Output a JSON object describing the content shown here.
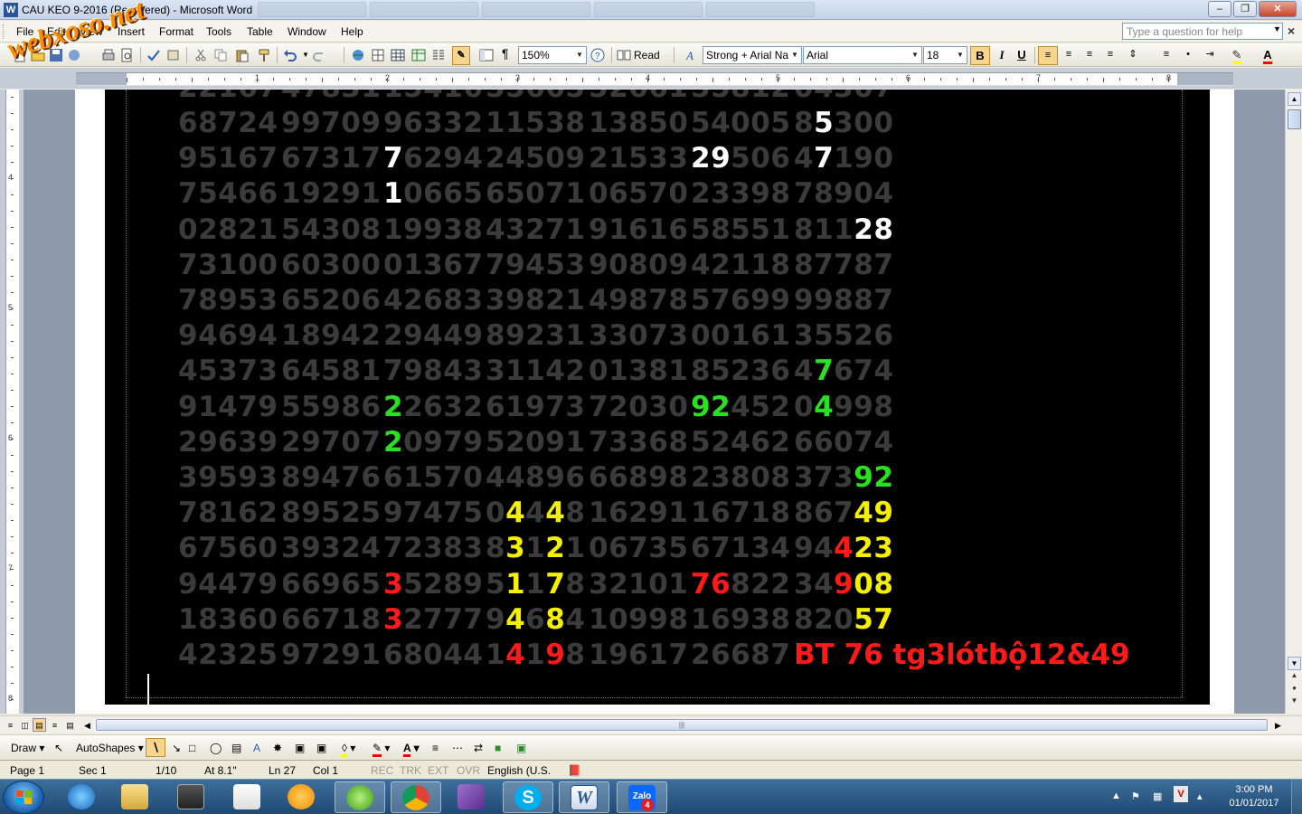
{
  "window": {
    "title": "CAU KEO 9-2016 (Recovered) - Microsoft Word",
    "controls": [
      "minimize",
      "restore",
      "close"
    ]
  },
  "watermark": "webxoso.net",
  "menu": {
    "items": [
      "File",
      "Edit",
      "View",
      "Insert",
      "Format",
      "Tools",
      "Table",
      "Window",
      "Help"
    ],
    "help_placeholder": "Type a question for help"
  },
  "toolbar": {
    "zoom": "150%",
    "read_label": "Read",
    "style": "Strong + Arial Na",
    "font": "Arial",
    "font_size": "18",
    "bold_label": "B",
    "italic_label": "I",
    "underline_label": "U"
  },
  "ruler": {
    "numbers": [
      "1",
      "2",
      "3",
      "4",
      "5",
      "6",
      "7",
      "8"
    ],
    "vnumbers": [
      "4",
      "5",
      "6",
      "7",
      "8"
    ]
  },
  "document": {
    "first_row_partial": [
      "22167",
      "47831",
      "15416",
      "55665",
      "52661",
      "55812",
      "04307"
    ],
    "rows": [
      [
        "68724",
        "99709",
        "96332",
        "11538",
        "13850",
        "54005",
        "85300"
      ],
      [
        "95167",
        "67317",
        "76294",
        "24509",
        "21533",
        "29506",
        "47190"
      ],
      [
        "75466",
        "19291",
        "10665",
        "65071",
        "06570",
        "23398",
        "78904"
      ],
      [
        "02821",
        "54308",
        "19938",
        "43271",
        "91616",
        "58551",
        "81128"
      ],
      [
        "73100",
        "60300",
        "01367",
        "79453",
        "90809",
        "42118",
        "87787"
      ],
      [
        "78953",
        "65206",
        "42683",
        "39821",
        "49878",
        "57699",
        "99887"
      ],
      [
        "94694",
        "18942",
        "29449",
        "89231",
        "33073",
        "00161",
        "35526"
      ],
      [
        "45373",
        "64581",
        "79843",
        "31142",
        "01381",
        "85236",
        "47674"
      ],
      [
        "91479",
        "55986",
        "22632",
        "61973",
        "72030",
        "92452",
        "04998"
      ],
      [
        "29639",
        "29707",
        "20979",
        "52091",
        "73368",
        "52462",
        "66074"
      ],
      [
        "39593",
        "89476",
        "61570",
        "44896",
        "66898",
        "23808",
        "37392"
      ],
      [
        "78162",
        "89525",
        "97475",
        "04448",
        "16291",
        "16718",
        "86749"
      ],
      [
        "67560",
        "39324",
        "72383",
        "83121",
        "06735",
        "67134",
        "94423"
      ],
      [
        "94479",
        "66965",
        "35289",
        "51178",
        "32101",
        "76822",
        "34908"
      ],
      [
        "18360",
        "66718",
        "32777",
        "94684",
        "10998",
        "16938",
        "82057"
      ],
      [
        "42325",
        "97291",
        "68044",
        "14198",
        "19617",
        "26687",
        ""
      ]
    ],
    "note": "BT 76 tg3lótbộ12&49",
    "highlight_colors": {
      "white": "#ffffff",
      "green": "#28e21f",
      "yellow": "#f5f000",
      "red": "#ff1a1a",
      "dim_digits": "#3b3b3b"
    }
  },
  "draw_toolbar": {
    "draw_label": "Draw",
    "autoshapes_label": "AutoShapes"
  },
  "status": {
    "page": "Page 1",
    "sec": "Sec 1",
    "pages": "1/10",
    "at": "At 8.1\"",
    "ln": "Ln 27",
    "col": "Col 1",
    "rec": "REC",
    "trk": "TRK",
    "ext": "EXT",
    "ovr": "OVR",
    "language": "English (U.S."
  },
  "taskbar": {
    "zalo_badge": "4",
    "time": "3:00 PM",
    "date": "01/01/2017"
  }
}
